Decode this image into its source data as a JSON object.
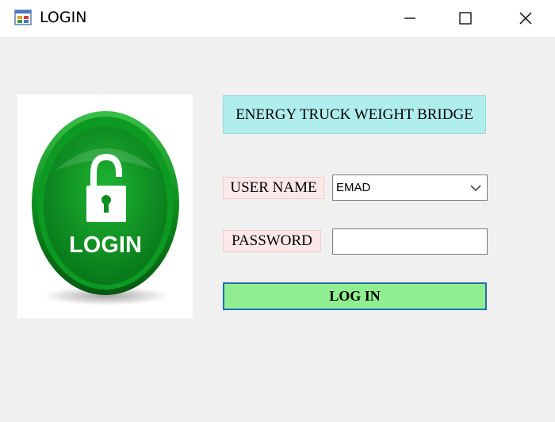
{
  "window": {
    "title": "LOGIN",
    "controls": {
      "minimize_icon": "minimize-icon",
      "maximize_icon": "maximize-icon",
      "close_icon": "close-icon"
    }
  },
  "logo": {
    "text": "LOGIN",
    "icon": "padlock-open-icon",
    "colors": {
      "outer": "#0a8a1a",
      "inner": "#13a52a",
      "text": "#ffffff"
    }
  },
  "form": {
    "app_title": "ENERGY TRUCK WEIGHT BRIDGE",
    "username_label": "USER NAME",
    "username_value": "EMAD",
    "password_label": "PASSWORD",
    "password_value": "",
    "login_button": "LOG IN"
  },
  "colors": {
    "title_bg": "#b0eeee",
    "label_bg": "#fde8e8",
    "button_bg": "#90ee90",
    "button_border": "#1c6fb8"
  }
}
